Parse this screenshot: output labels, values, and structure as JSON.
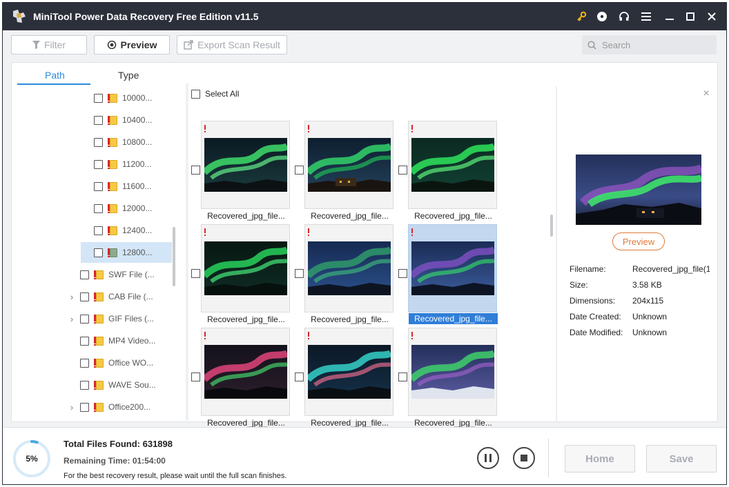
{
  "window": {
    "title": "MiniTool Power Data Recovery Free Edition v11.5",
    "icons": [
      "key-icon",
      "disc-icon",
      "headphones-icon",
      "menu-icon",
      "minimize-icon",
      "maximize-icon",
      "close-icon"
    ]
  },
  "toolbar": {
    "filter_label": "Filter",
    "preview_label": "Preview",
    "export_label": "Export Scan Result",
    "search_placeholder": "Search"
  },
  "tabs": [
    {
      "label": "Path",
      "active": true
    },
    {
      "label": "Type",
      "active": false
    }
  ],
  "tree": [
    {
      "label": "10000...",
      "level": 2,
      "expandable": false,
      "selected": false
    },
    {
      "label": "10400...",
      "level": 2,
      "expandable": false,
      "selected": false
    },
    {
      "label": "10800...",
      "level": 2,
      "expandable": false,
      "selected": false
    },
    {
      "label": "11200...",
      "level": 2,
      "expandable": false,
      "selected": false
    },
    {
      "label": "11600...",
      "level": 2,
      "expandable": false,
      "selected": false
    },
    {
      "label": "12000...",
      "level": 2,
      "expandable": false,
      "selected": false
    },
    {
      "label": "12400...",
      "level": 2,
      "expandable": false,
      "selected": false
    },
    {
      "label": "12800...",
      "level": 2,
      "expandable": false,
      "selected": true
    },
    {
      "label": "SWF File (...",
      "level": 1,
      "expandable": false,
      "selected": false
    },
    {
      "label": "CAB File (...",
      "level": 1,
      "expandable": true,
      "selected": false
    },
    {
      "label": "GIF Files (...",
      "level": 1,
      "expandable": true,
      "selected": false
    },
    {
      "label": "MP4 Video...",
      "level": 1,
      "expandable": false,
      "selected": false
    },
    {
      "label": "Office WO...",
      "level": 1,
      "expandable": false,
      "selected": false
    },
    {
      "label": "WAVE Sou...",
      "level": 1,
      "expandable": false,
      "selected": false
    },
    {
      "label": "Office200...",
      "level": 1,
      "expandable": true,
      "selected": false
    }
  ],
  "grid": {
    "select_all_label": "Select All",
    "items": [
      {
        "name": "Recovered_jpg_file...",
        "selected": false
      },
      {
        "name": "Recovered_jpg_file...",
        "selected": false
      },
      {
        "name": "Recovered_jpg_file...",
        "selected": false
      },
      {
        "name": "Recovered_jpg_file...",
        "selected": false
      },
      {
        "name": "Recovered_jpg_file...",
        "selected": false
      },
      {
        "name": "Recovered_jpg_file...",
        "selected": true
      },
      {
        "name": "Recovered_jpg_file...",
        "selected": false
      },
      {
        "name": "Recovered_jpg_file...",
        "selected": false
      },
      {
        "name": "Recovered_jpg_file...",
        "selected": false
      }
    ]
  },
  "preview_panel": {
    "button_label": "Preview",
    "fields": [
      {
        "label": "Filename:",
        "value": "Recovered_jpg_file(1"
      },
      {
        "label": "Size:",
        "value": "3.58 KB"
      },
      {
        "label": "Dimensions:",
        "value": "204x115"
      },
      {
        "label": "Date Created:",
        "value": "Unknown"
      },
      {
        "label": "Date Modified:",
        "value": "Unknown"
      }
    ]
  },
  "status": {
    "progress_percent": 5,
    "progress_label": "5%",
    "total_files_label": "Total Files Found:",
    "total_files_value": "631898",
    "remaining_label": "Remaining Time:",
    "remaining_value": "01:54:00",
    "hint": "For the best recovery result, please wait until the full scan finishes.",
    "home_label": "Home",
    "save_label": "Save"
  },
  "colors": {
    "accent": "#2b8ad8",
    "titlebar": "#2c303b",
    "progress": "#4aa6e0",
    "preview_button": "#e07a3c",
    "selection": "#2f7ed8"
  }
}
